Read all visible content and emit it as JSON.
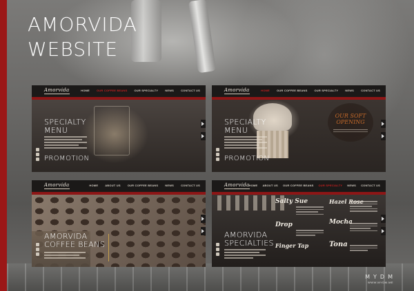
{
  "page": {
    "title_lines": [
      "AMORVIDA",
      "WEBSITE"
    ],
    "accent_color": "#9b1717"
  },
  "thumbnails": [
    {
      "logo": "Amorvida",
      "nav": [
        "HOME",
        "OUR COFFEE BEANS",
        "OUR SPECIALTY",
        "NEWS",
        "CONTACT US"
      ],
      "active_nav": 1,
      "heading": [
        "SPECIALTY",
        "MENU"
      ],
      "secondary": "PROMOTION",
      "icons": [
        "facebook-icon",
        "twitter-icon",
        "instagram-icon"
      ]
    },
    {
      "logo": "Amorvida",
      "nav": [
        "HOME",
        "OUR COFFEE BEANS",
        "OUR SPECIALTY",
        "NEWS",
        "CONTACT US"
      ],
      "active_nav": 0,
      "heading": [
        "SPECIALTY",
        "MENU"
      ],
      "secondary": "PROMOTION",
      "badge": [
        "OUR SOFT",
        "OPENING"
      ],
      "icons": [
        "facebook-icon",
        "twitter-icon",
        "instagram-icon"
      ]
    },
    {
      "logo": "Amorvida",
      "nav": [
        "HOME",
        "ABOUT US",
        "OUR COFFEE BEANS",
        "NEWS",
        "CONTACT US"
      ],
      "active_nav": -1,
      "heading": [
        "AMORVIDA",
        "COFFEE BEANS"
      ],
      "icons": [
        "facebook-icon",
        "twitter-icon",
        "instagram-icon"
      ]
    },
    {
      "logo": "Amorvida",
      "nav": [
        "HOME",
        "ABOUT US",
        "OUR COFFEE BEANS",
        "OUR SPECIALTY",
        "NEWS",
        "CONTACT US"
      ],
      "active_nav": 3,
      "heading": [
        "AMORVIDA",
        "SPECIALTIES"
      ],
      "menu_script": [
        "Salty Sue",
        "Drop",
        "Finger Tap",
        "Hazel Rose",
        "Mocha",
        "Tona"
      ],
      "icons": [
        "facebook-icon",
        "twitter-icon",
        "instagram-icon"
      ]
    }
  ],
  "watermark": {
    "main": "MYDM",
    "sub": "WWW.MYDM.ME"
  }
}
